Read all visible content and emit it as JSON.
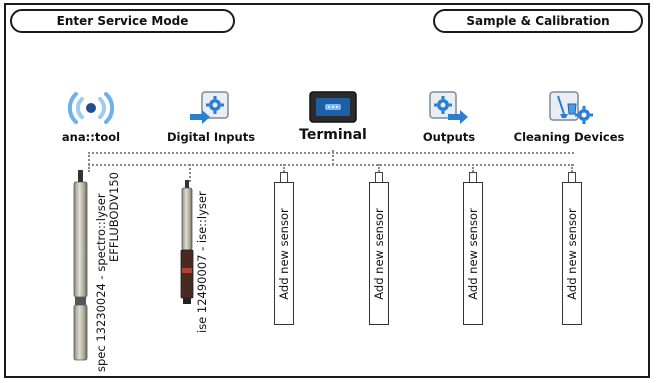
{
  "header": {
    "service_mode_label": "Enter Service Mode",
    "sample_calibration_label": "Sample & Calibration"
  },
  "tools": {
    "ana_tool": {
      "label": "ana::tool",
      "icon": "wifi-signal-icon"
    },
    "digital_inputs": {
      "label": "Digital Inputs",
      "icon": "gear-arrow-in-icon"
    },
    "terminal": {
      "label": "Terminal",
      "icon": "terminal-icon"
    },
    "outputs": {
      "label": "Outputs",
      "icon": "gear-arrow-out-icon"
    },
    "cleaning_devices": {
      "label": "Cleaning Devices",
      "icon": "broom-bucket-gear-icon"
    }
  },
  "sensors": {
    "spectro_line1": "spec 13230024 - spectro::lyser",
    "spectro_line2": "EFFLUBODV150",
    "ise_label": "ise 12490007 - ise::lyser",
    "slot1": "Add new sensor",
    "slot2": "Add new sensor",
    "slot3": "Add new sensor",
    "slot4": "Add new sensor"
  },
  "colors": {
    "accent_blue": "#2a7fd0",
    "connector_gray": "#8a8a8a",
    "border": "#1a1a1a"
  }
}
